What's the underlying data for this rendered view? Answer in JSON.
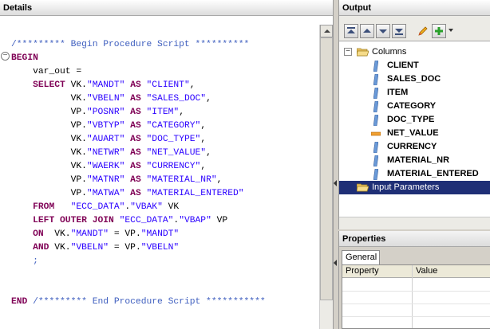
{
  "details": {
    "title": "Details",
    "code_lines": [
      [
        {
          "t": "/********* Begin Procedure Script **********",
          "c": "cm"
        }
      ],
      [
        {
          "t": "BEGIN",
          "c": "kw"
        }
      ],
      [
        {
          "t": "    var_out =",
          "c": ""
        }
      ],
      [
        {
          "t": "    ",
          "c": ""
        },
        {
          "t": "SELECT",
          "c": "kw"
        },
        {
          "t": " VK.",
          "c": ""
        },
        {
          "t": "\"MANDT\"",
          "c": "str"
        },
        {
          "t": " ",
          "c": ""
        },
        {
          "t": "AS",
          "c": "kw"
        },
        {
          "t": " ",
          "c": ""
        },
        {
          "t": "\"CLIENT\"",
          "c": "str"
        },
        {
          "t": ",",
          "c": ""
        }
      ],
      [
        {
          "t": "           VK.",
          "c": ""
        },
        {
          "t": "\"VBELN\"",
          "c": "str"
        },
        {
          "t": " ",
          "c": ""
        },
        {
          "t": "AS",
          "c": "kw"
        },
        {
          "t": " ",
          "c": ""
        },
        {
          "t": "\"SALES_DOC\"",
          "c": "str"
        },
        {
          "t": ",",
          "c": ""
        }
      ],
      [
        {
          "t": "           VP.",
          "c": ""
        },
        {
          "t": "\"POSNR\"",
          "c": "str"
        },
        {
          "t": " ",
          "c": ""
        },
        {
          "t": "AS",
          "c": "kw"
        },
        {
          "t": " ",
          "c": ""
        },
        {
          "t": "\"ITEM\"",
          "c": "str"
        },
        {
          "t": ",",
          "c": ""
        }
      ],
      [
        {
          "t": "           VP.",
          "c": ""
        },
        {
          "t": "\"VBTYP\"",
          "c": "str"
        },
        {
          "t": " ",
          "c": ""
        },
        {
          "t": "AS",
          "c": "kw"
        },
        {
          "t": " ",
          "c": ""
        },
        {
          "t": "\"CATEGORY\"",
          "c": "str"
        },
        {
          "t": ",",
          "c": ""
        }
      ],
      [
        {
          "t": "           VK.",
          "c": ""
        },
        {
          "t": "\"AUART\"",
          "c": "str"
        },
        {
          "t": " ",
          "c": ""
        },
        {
          "t": "AS",
          "c": "kw"
        },
        {
          "t": " ",
          "c": ""
        },
        {
          "t": "\"DOC_TYPE\"",
          "c": "str"
        },
        {
          "t": ",",
          "c": ""
        }
      ],
      [
        {
          "t": "           VK.",
          "c": ""
        },
        {
          "t": "\"NETWR\"",
          "c": "str"
        },
        {
          "t": " ",
          "c": ""
        },
        {
          "t": "AS",
          "c": "kw"
        },
        {
          "t": " ",
          "c": ""
        },
        {
          "t": "\"NET_VALUE\"",
          "c": "str"
        },
        {
          "t": ",",
          "c": ""
        }
      ],
      [
        {
          "t": "           VK.",
          "c": ""
        },
        {
          "t": "\"WAERK\"",
          "c": "str"
        },
        {
          "t": " ",
          "c": ""
        },
        {
          "t": "AS",
          "c": "kw"
        },
        {
          "t": " ",
          "c": ""
        },
        {
          "t": "\"CURRENCY\"",
          "c": "str"
        },
        {
          "t": ",",
          "c": ""
        }
      ],
      [
        {
          "t": "           VP.",
          "c": ""
        },
        {
          "t": "\"MATNR\"",
          "c": "str"
        },
        {
          "t": " ",
          "c": ""
        },
        {
          "t": "AS",
          "c": "kw"
        },
        {
          "t": " ",
          "c": ""
        },
        {
          "t": "\"MATERIAL_NR\"",
          "c": "str"
        },
        {
          "t": ",",
          "c": ""
        }
      ],
      [
        {
          "t": "           VP.",
          "c": ""
        },
        {
          "t": "\"MATWA\"",
          "c": "str"
        },
        {
          "t": " ",
          "c": ""
        },
        {
          "t": "AS",
          "c": "kw"
        },
        {
          "t": " ",
          "c": ""
        },
        {
          "t": "\"MATERIAL_ENTERED\"",
          "c": "str"
        }
      ],
      [
        {
          "t": "    ",
          "c": ""
        },
        {
          "t": "FROM",
          "c": "kw"
        },
        {
          "t": "   ",
          "c": ""
        },
        {
          "t": "\"ECC_DATA\"",
          "c": "str"
        },
        {
          "t": ".",
          "c": ""
        },
        {
          "t": "\"VBAK\"",
          "c": "str"
        },
        {
          "t": " VK",
          "c": ""
        }
      ],
      [
        {
          "t": "    ",
          "c": ""
        },
        {
          "t": "LEFT OUTER JOIN",
          "c": "kw"
        },
        {
          "t": " ",
          "c": ""
        },
        {
          "t": "\"ECC_DATA\"",
          "c": "str"
        },
        {
          "t": ".",
          "c": ""
        },
        {
          "t": "\"VBAP\"",
          "c": "str"
        },
        {
          "t": " VP",
          "c": ""
        }
      ],
      [
        {
          "t": "    ",
          "c": ""
        },
        {
          "t": "ON",
          "c": "kw"
        },
        {
          "t": "  VK.",
          "c": ""
        },
        {
          "t": "\"MANDT\"",
          "c": "str"
        },
        {
          "t": " = VP.",
          "c": ""
        },
        {
          "t": "\"MANDT\"",
          "c": "str"
        }
      ],
      [
        {
          "t": "    ",
          "c": ""
        },
        {
          "t": "AND",
          "c": "kw"
        },
        {
          "t": " VK.",
          "c": ""
        },
        {
          "t": "\"VBELN\"",
          "c": "str"
        },
        {
          "t": " = VP.",
          "c": ""
        },
        {
          "t": "\"VBELN\"",
          "c": "str"
        }
      ],
      [
        {
          "t": "    ;",
          "c": "cm"
        }
      ],
      [
        {
          "t": "",
          "c": ""
        }
      ],
      [
        {
          "t": "",
          "c": ""
        }
      ],
      [
        {
          "t": "END",
          "c": "kw"
        },
        {
          "t": " ",
          "c": ""
        },
        {
          "t": "/********* End Procedure Script ***********",
          "c": "cm"
        }
      ]
    ]
  },
  "output": {
    "title": "Output",
    "toolbar": {
      "buttons": [
        "move-top-icon",
        "move-up-icon",
        "move-down-icon",
        "move-bottom-icon",
        "edit-icon",
        "add-icon",
        "dropdown-arrow-icon"
      ]
    },
    "tree": {
      "columns_label": "Columns",
      "columns": [
        "CLIENT",
        "SALES_DOC",
        "ITEM",
        "CATEGORY",
        "DOC_TYPE",
        "NET_VALUE",
        "CURRENCY",
        "MATERIAL_NR",
        "MATERIAL_ENTERED"
      ],
      "input_parameters_label": "Input Parameters"
    }
  },
  "properties": {
    "title": "Properties",
    "tab": "General",
    "headers": [
      "Property",
      "Value"
    ]
  },
  "colors": {
    "keyword": "#7f0055",
    "string": "#2a00ff",
    "comment": "#3f5fbf",
    "selection": "#1f2f76"
  }
}
